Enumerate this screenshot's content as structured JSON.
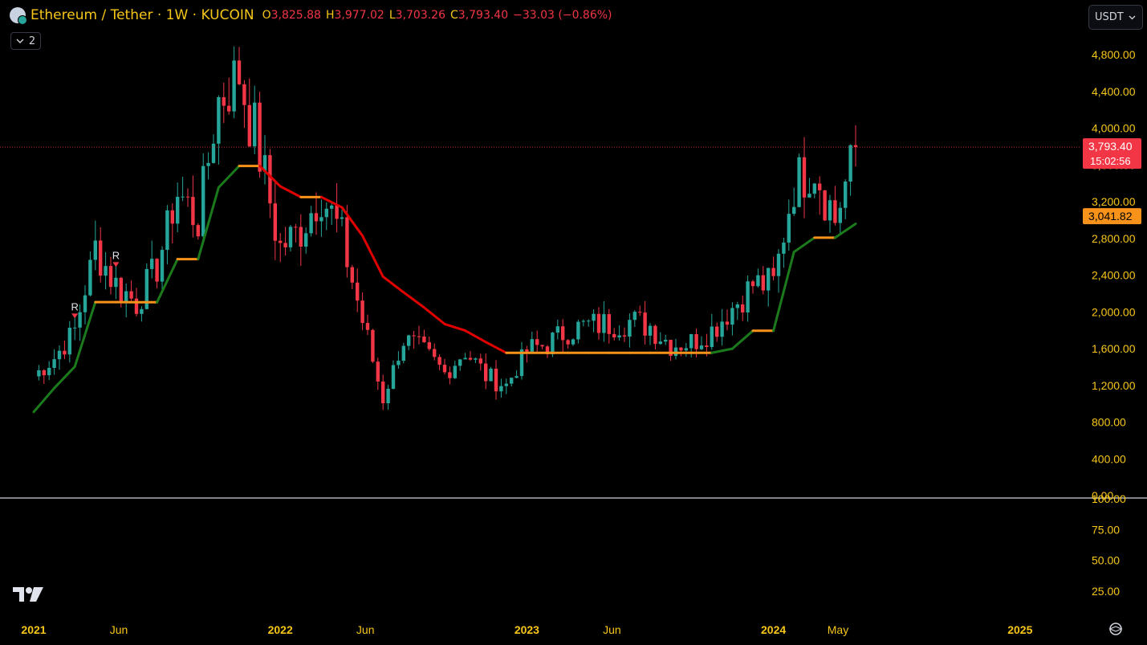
{
  "header": {
    "symbol_title": "Ethereum / Tether · 1W · KUCOIN",
    "ohlc": [
      {
        "key": "O",
        "value": "3,825.88"
      },
      {
        "key": "H",
        "value": "3,977.02"
      },
      {
        "key": "L",
        "value": "3,703.26"
      },
      {
        "key": "C",
        "value": "3,793.40"
      }
    ],
    "change": "−33.03 (−0.86%)",
    "indicator_count": "2"
  },
  "currency_selector": {
    "label": "USDT"
  },
  "colors": {
    "up": "#26a69a",
    "down": "#f23645",
    "accent": "#f5c518",
    "orange": "#f7931a",
    "green": "#1b7a1b",
    "red": "#e10000"
  },
  "chart_data": {
    "type": "candlestick",
    "symbol": "ETH/USDT",
    "interval": "1W",
    "y_axis": {
      "range": [
        0,
        4800
      ],
      "ticks": [
        "4,800.00",
        "4,400.00",
        "4,000.00",
        "3,600.00",
        "3,200.00",
        "2,800.00",
        "2,400.00",
        "2,000.00",
        "1,600.00",
        "1,200.00",
        "800.00",
        "400.00",
        "0.00"
      ]
    },
    "x_axis": {
      "ticks": [
        "2021",
        "Jun",
        "2022",
        "Jun",
        "2023",
        "Jun",
        "2024",
        "May",
        "2025"
      ]
    },
    "last_price": {
      "value": 3793.4,
      "label": "3,793.40",
      "countdown": "15:02:56"
    },
    "indicator_value": {
      "value": 3041.82,
      "label": "3,041.82"
    },
    "lower_pane": {
      "ticks": [
        "100.00",
        "75.00",
        "50.00",
        "25.00"
      ]
    },
    "markers": [
      {
        "text": "R",
        "date": "2021-03"
      },
      {
        "text": "R",
        "date": "2021-05"
      }
    ],
    "closes": [
      {
        "t": "2021-01",
        "c": 1300
      },
      {
        "t": "2021-02",
        "c": 1500
      },
      {
        "t": "2021-03",
        "c": 1800
      },
      {
        "t": "2021-04",
        "c": 2700
      },
      {
        "t": "2021-05",
        "c": 2300
      },
      {
        "t": "2021-06",
        "c": 2100
      },
      {
        "t": "2021-07",
        "c": 2500
      },
      {
        "t": "2021-08",
        "c": 3300
      },
      {
        "t": "2021-09",
        "c": 3000
      },
      {
        "t": "2021-10",
        "c": 4300
      },
      {
        "t": "2021-11",
        "c": 4600
      },
      {
        "t": "2021-12",
        "c": 3700
      },
      {
        "t": "2022-01",
        "c": 2700
      },
      {
        "t": "2022-02",
        "c": 2900
      },
      {
        "t": "2022-03",
        "c": 3300
      },
      {
        "t": "2022-04",
        "c": 2800
      },
      {
        "t": "2022-05",
        "c": 1900
      },
      {
        "t": "2022-06",
        "c": 1050
      },
      {
        "t": "2022-07",
        "c": 1700
      },
      {
        "t": "2022-08",
        "c": 1550
      },
      {
        "t": "2022-09",
        "c": 1330
      },
      {
        "t": "2022-10",
        "c": 1580
      },
      {
        "t": "2022-11",
        "c": 1300
      },
      {
        "t": "2022-12",
        "c": 1200
      },
      {
        "t": "2023-01",
        "c": 1580
      },
      {
        "t": "2023-02",
        "c": 1650
      },
      {
        "t": "2023-03",
        "c": 1800
      },
      {
        "t": "2023-04",
        "c": 1850
      },
      {
        "t": "2023-05",
        "c": 1870
      },
      {
        "t": "2023-06",
        "c": 1900
      },
      {
        "t": "2023-07",
        "c": 1850
      },
      {
        "t": "2023-08",
        "c": 1650
      },
      {
        "t": "2023-09",
        "c": 1670
      },
      {
        "t": "2023-10",
        "c": 1800
      },
      {
        "t": "2023-11",
        "c": 2050
      },
      {
        "t": "2023-12",
        "c": 2300
      },
      {
        "t": "2024-01",
        "c": 2300
      },
      {
        "t": "2024-02",
        "c": 3400
      },
      {
        "t": "2024-03",
        "c": 3600
      },
      {
        "t": "2024-04",
        "c": 3000
      },
      {
        "t": "2024-05",
        "c": 3793.4
      }
    ]
  }
}
